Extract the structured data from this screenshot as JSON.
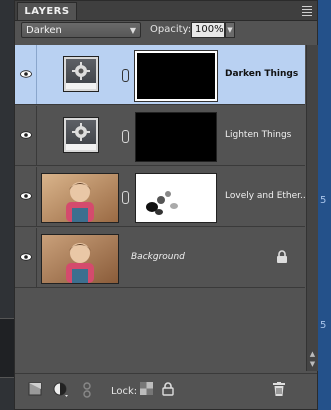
{
  "panel": {
    "tab_label": "LAYERS",
    "blend_mode": "Darken",
    "opacity_label": "Opacity:",
    "opacity_value": "100%"
  },
  "layers": [
    {
      "name": "Darken Things",
      "type": "adjustment",
      "visible": true,
      "selected": true,
      "mask": "black"
    },
    {
      "name": "Lighten Things",
      "type": "adjustment",
      "visible": true,
      "selected": false,
      "mask": "black"
    },
    {
      "name": "Lovely and Ether...",
      "type": "photo",
      "visible": true,
      "selected": false,
      "mask": "white-with-spots"
    },
    {
      "name": "Background",
      "type": "photo",
      "visible": true,
      "selected": false,
      "locked": true
    }
  ],
  "bottom_bar": {
    "lock_label": "Lock:"
  },
  "colors": {
    "panel_bg": "#535353",
    "selection": "#b9d1f2",
    "backdrop_right": "#24518a"
  }
}
